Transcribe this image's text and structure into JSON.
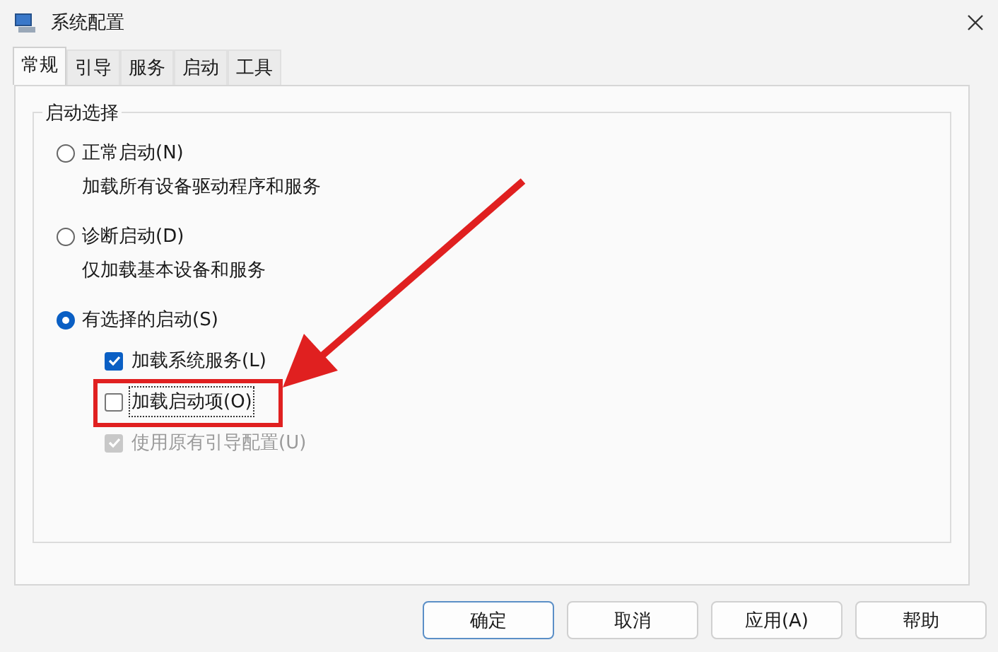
{
  "window": {
    "title": "系统配置"
  },
  "tabs": [
    {
      "label": "常规",
      "selected": true
    },
    {
      "label": "引导",
      "selected": false
    },
    {
      "label": "服务",
      "selected": false
    },
    {
      "label": "启动",
      "selected": false
    },
    {
      "label": "工具",
      "selected": false
    }
  ],
  "group": {
    "title": "启动选择",
    "options": [
      {
        "label": "正常启动(N)",
        "description": "加载所有设备驱动程序和服务",
        "selected": false
      },
      {
        "label": "诊断启动(D)",
        "description": "仅加载基本设备和服务",
        "selected": false
      },
      {
        "label": "有选择的启动(S)",
        "selected": true,
        "checkboxes": [
          {
            "label": "加载系统服务(L)",
            "checked": true,
            "disabled": false,
            "focused": false,
            "highlighted": false
          },
          {
            "label": "加载启动项(O)",
            "checked": false,
            "disabled": false,
            "focused": true,
            "highlighted": true
          },
          {
            "label": "使用原有引导配置(U)",
            "checked": true,
            "disabled": true,
            "focused": false,
            "highlighted": false
          }
        ]
      }
    ]
  },
  "buttons": [
    {
      "label": "确定",
      "default": true
    },
    {
      "label": "取消",
      "default": false
    },
    {
      "label": "应用(A)",
      "default": false
    },
    {
      "label": "帮助",
      "default": false
    }
  ]
}
